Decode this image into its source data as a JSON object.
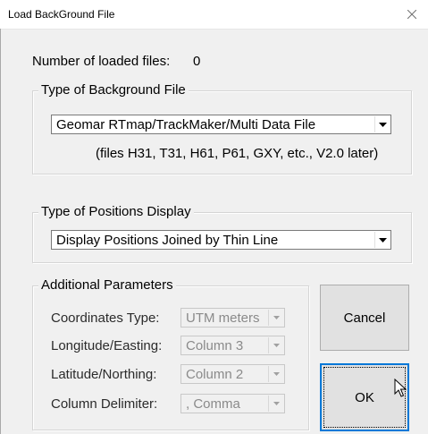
{
  "window": {
    "title": "Load BackGround File"
  },
  "loaded_files": {
    "label": "Number of loaded files:",
    "count": "0"
  },
  "background_type": {
    "legend": "Type of Background File",
    "selected": "Geomar RTmap/TrackMaker/Multi Data File",
    "note": "(files H31, T31, H61, P61, GXY, etc., V2.0  later)"
  },
  "positions_display": {
    "legend": "Type of Positions Display",
    "selected": "Display Positions Joined by Thin Line"
  },
  "additional_params": {
    "legend": "Additional Parameters",
    "coordinates_type": {
      "label": "Coordinates Type:",
      "value": "UTM meters"
    },
    "longitude": {
      "label": "Longitude/Easting:",
      "value": "Column 3"
    },
    "latitude": {
      "label": "Latitude/Northing:",
      "value": "Column 2"
    },
    "delimiter": {
      "label": "Column Delimiter:",
      "value": ", Comma"
    }
  },
  "buttons": {
    "cancel": "Cancel",
    "ok": "OK"
  },
  "colors": {
    "dialog_bg": "#f0f0f0",
    "default_button_border": "#0078d7",
    "disabled_text": "#8a8a8a"
  }
}
